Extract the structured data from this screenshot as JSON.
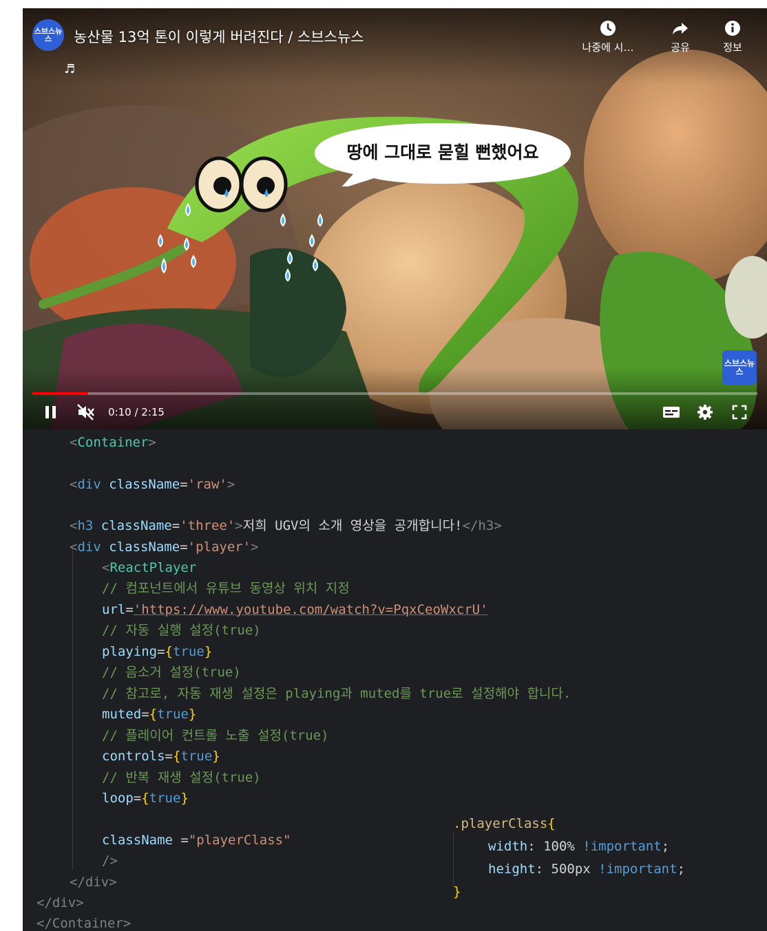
{
  "video": {
    "title": "농산물 13억 톤이 이렇게 버려진다 / 스브스뉴스",
    "channel_logo_text": "스브스뉴스",
    "music_note": "♬",
    "actions": [
      {
        "label": "나중에 시…",
        "icon": "clock-icon"
      },
      {
        "label": "공유",
        "icon": "share-icon"
      },
      {
        "label": "정보",
        "icon": "info-icon"
      }
    ],
    "speech_bubble": "땅에 그대로 묻힐 뻔했어요",
    "watermark_text": "스브스뉴스",
    "time": "0:10 / 2:15",
    "progress": 0.077,
    "colors": {
      "progress": "#ff0000",
      "channel": "#2e5fd6"
    }
  },
  "code": {
    "l1_open": "<",
    "l1_tag": "Container",
    "l1_close": ">",
    "l2_open": "<",
    "l2_tag": "div",
    "l2_attr": "className",
    "l2_eq": "=",
    "l2_val": "'raw'",
    "l2_close": ">",
    "l3_open": "<",
    "l3_tag": "h3",
    "l3_attr": "className",
    "l3_eq": "=",
    "l3_val": "'three'",
    "l3_close": ">",
    "l3_text": "저희 UGV의 소개 영상을 공개합니다!",
    "l3_end": "</h3>",
    "l4_open": "<",
    "l4_tag": "div",
    "l4_attr": "className",
    "l4_eq": "=",
    "l4_val": "'player'",
    "l4_close": ">",
    "l5_open": "<",
    "l5_tag": "ReactPlayer",
    "c1": "// 컴포넌트에서 유튜브 동영상 위치 지정",
    "url_attr": "url",
    "url_eq": "=",
    "url_val": "'https://www.youtube.com/watch?v=PqxCeoWxcrU'",
    "c2": "// 자동 실행 설정(true)",
    "p_attr": "playing",
    "p_eq": "=",
    "p_ob": "{",
    "p_val": "true",
    "p_cb": "}",
    "c3": "// 음소거 설정(true)",
    "c4": "// 참고로, 자동 재생 설정은 playing과 muted를 true로 설정해야 합니다.",
    "m_attr": "muted",
    "m_eq": "=",
    "m_ob": "{",
    "m_val": "true",
    "m_cb": "}",
    "c5": "// 플레이어 컨트롤 노출 설정(true)",
    "ct_attr": "controls",
    "ct_eq": "=",
    "ct_ob": "{",
    "ct_val": "true",
    "ct_cb": "}",
    "c6": "// 반복 재생 설정(true)",
    "lp_attr": "loop",
    "lp_eq": "=",
    "lp_ob": "{",
    "lp_val": "true",
    "lp_cb": "}",
    "cn_attr": "className ",
    "cn_eq": "=",
    "cn_val": "\"playerClass\"",
    "selfclose": "/>",
    "div_end1": "</div>",
    "div_end2": "</div>",
    "container_end": "</Container>"
  },
  "css": {
    "selector": ".playerClass",
    "open": "{",
    "w_prop": "width",
    "w_colon": ": ",
    "w_val": "100%",
    "w_imp": " !important",
    "w_semi": ";",
    "h_prop": "height",
    "h_colon": ": ",
    "h_val": "500px",
    "h_imp": " !important",
    "h_semi": ";",
    "close": "}"
  }
}
